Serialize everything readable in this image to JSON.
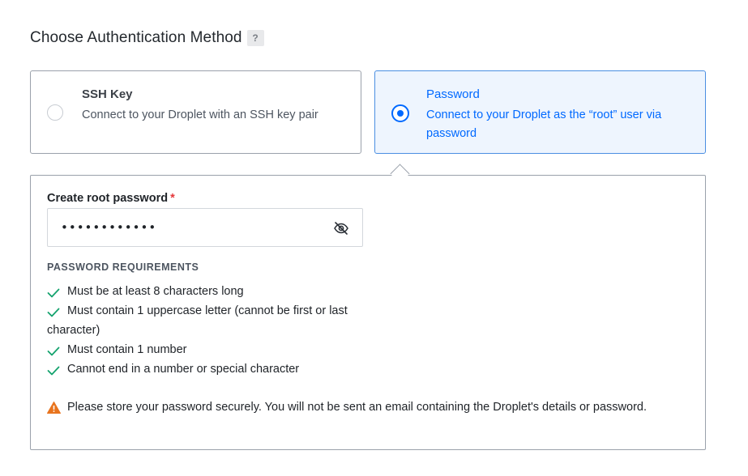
{
  "section": {
    "title": "Choose Authentication Method",
    "help_badge": "?"
  },
  "auth_options": [
    {
      "title": "SSH Key",
      "description": "Connect to your Droplet with an SSH key pair",
      "selected": false
    },
    {
      "title": "Password",
      "description": "Connect to your Droplet as the “root” user via password",
      "selected": true
    }
  ],
  "password_panel": {
    "label": "Create root password",
    "required_marker": "*",
    "value": "••••••••••••",
    "toggle_icon": "eye-slash-icon",
    "requirements_heading": "PASSWORD REQUIREMENTS",
    "requirements": [
      {
        "text": "Must be at least 8 characters long",
        "met": true
      },
      {
        "text": "Must contain 1 uppercase letter (cannot be first or last character)",
        "met": true
      },
      {
        "text": "Must contain 1 number",
        "met": true
      },
      {
        "text": "Cannot end in a number or special character",
        "met": true
      }
    ],
    "warning": "Please store your password securely. You will not be sent an email containing the Droplet's details or password."
  },
  "colors": {
    "accent": "#0069ff",
    "check": "#15a36e",
    "warning": "#e8741e",
    "required": "#e5383b"
  }
}
